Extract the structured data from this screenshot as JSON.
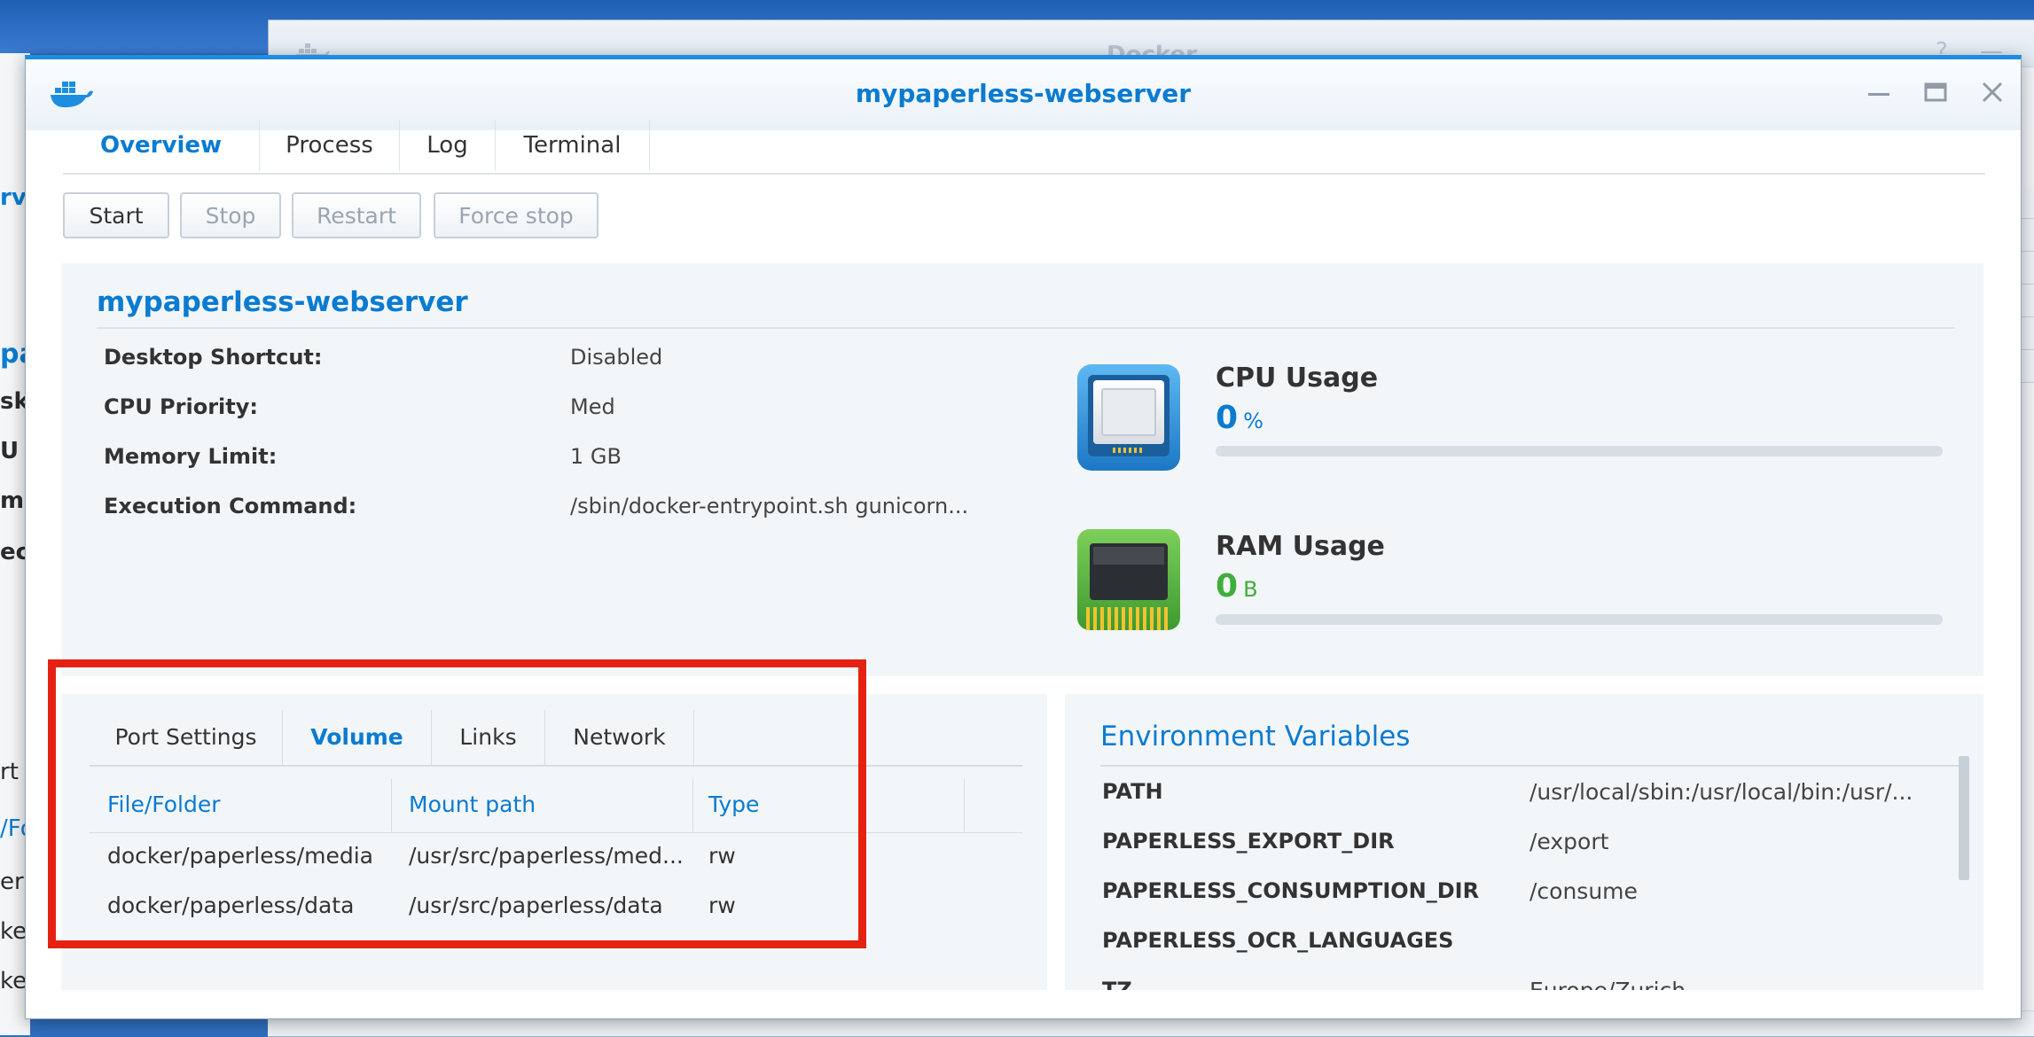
{
  "background": {
    "window_title": "Docker"
  },
  "window": {
    "title": "mypaperless-webserver",
    "tabs": [
      "Overview",
      "Process",
      "Log",
      "Terminal"
    ],
    "active_tab": "Overview"
  },
  "toolbar": {
    "start": "Start",
    "stop": "Stop",
    "restart": "Restart",
    "force_stop": "Force stop"
  },
  "overview": {
    "title": "mypaperless-webserver",
    "fields": [
      {
        "label": "Desktop Shortcut:",
        "value": "Disabled"
      },
      {
        "label": "CPU Priority:",
        "value": "Med"
      },
      {
        "label": "Memory Limit:",
        "value": "1 GB"
      },
      {
        "label": "Execution Command:",
        "value": "/sbin/docker-entrypoint.sh gunicorn..."
      }
    ],
    "cpu": {
      "label": "CPU Usage",
      "value": "0",
      "unit": "%",
      "fill": 0,
      "color": "#0a7bd1"
    },
    "ram": {
      "label": "RAM Usage",
      "value": "0",
      "unit": "B",
      "fill": 0,
      "color": "#3fae3a"
    }
  },
  "details": {
    "tabs": [
      "Port Settings",
      "Volume",
      "Links",
      "Network"
    ],
    "active_tab": "Volume",
    "columns": [
      "File/Folder",
      "Mount path",
      "Type"
    ],
    "rows": [
      [
        "docker/paperless/media",
        "/usr/src/paperless/med...",
        "rw"
      ],
      [
        "docker/paperless/data",
        "/usr/src/paperless/data",
        "rw"
      ]
    ],
    "highlight_color": "#e52212"
  },
  "environment": {
    "title": "Environment Variables",
    "vars": [
      {
        "key": "PATH",
        "value": "/usr/local/sbin:/usr/local/bin:/usr/..."
      },
      {
        "key": "PAPERLESS_EXPORT_DIR",
        "value": "/export"
      },
      {
        "key": "PAPERLESS_CONSUMPTION_DIR",
        "value": "/consume"
      },
      {
        "key": "PAPERLESS_OCR_LANGUAGES",
        "value": ""
      },
      {
        "key": "TZ",
        "value": "Europe/Zurich"
      }
    ]
  },
  "background_fragments": {
    "left": [
      "rvi",
      "pa",
      "skt",
      "U P",
      "mo",
      "ecu",
      "rt",
      "/Fo",
      "erl",
      "ke",
      "ke"
    ]
  },
  "colors": {
    "accent": "#0a7bd1",
    "titlebar_border": "#1c8de0",
    "ram_green": "#3fae3a"
  }
}
